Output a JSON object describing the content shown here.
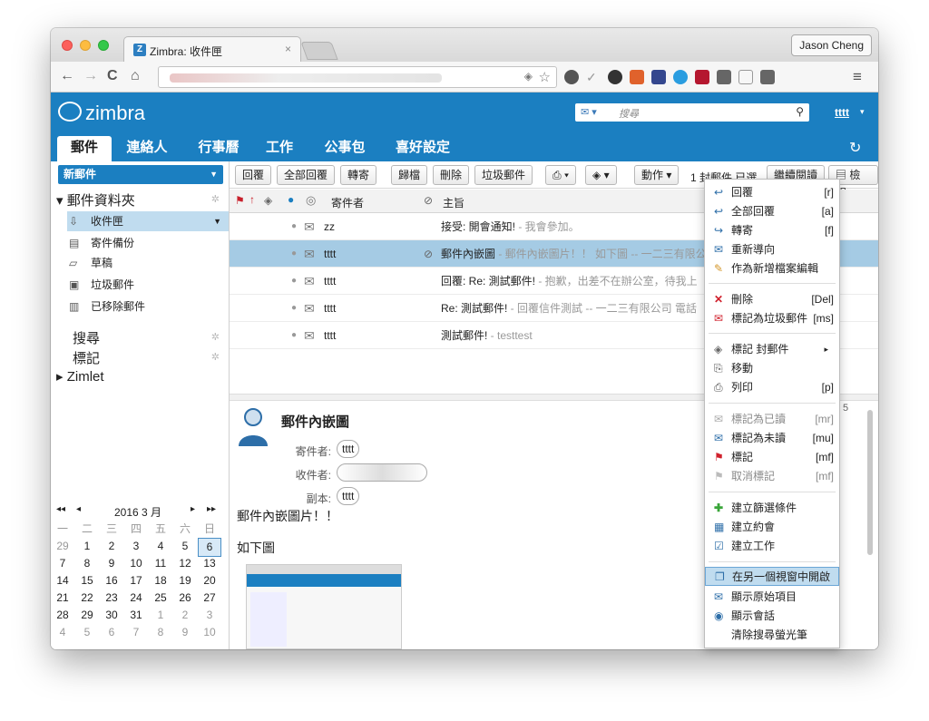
{
  "browser": {
    "tab_title": "Zimbra: 收件匣",
    "tab_close": "×",
    "user_button": "Jason Cheng"
  },
  "zimbra": {
    "logo": "zimbra",
    "search_placeholder": "搜尋",
    "user": "tttt",
    "app_tabs": [
      "郵件",
      "連絡人",
      "行事曆",
      "工作",
      "公事包",
      "喜好設定"
    ]
  },
  "sidebar": {
    "new_mail": "新郵件",
    "folders_header": "郵件資料夾",
    "folders": [
      "收件匣",
      "寄件備份",
      "草稿",
      "垃圾郵件",
      "已移除郵件"
    ],
    "search": "搜尋",
    "tags": "標記",
    "zimlet": "Zimlet"
  },
  "calendar": {
    "title": "2016 3 月",
    "weekdays": [
      "一",
      "二",
      "三",
      "四",
      "五",
      "六",
      "日"
    ],
    "weeks": [
      [
        "29",
        "1",
        "2",
        "3",
        "4",
        "5",
        "6"
      ],
      [
        "7",
        "8",
        "9",
        "10",
        "11",
        "12",
        "13"
      ],
      [
        "14",
        "15",
        "16",
        "17",
        "18",
        "19",
        "20"
      ],
      [
        "21",
        "22",
        "23",
        "24",
        "25",
        "26",
        "27"
      ],
      [
        "28",
        "29",
        "30",
        "31",
        "1",
        "2",
        "3"
      ],
      [
        "4",
        "5",
        "6",
        "7",
        "8",
        "9",
        "10"
      ]
    ],
    "today": "6"
  },
  "actions": {
    "reply": "回覆",
    "reply_all": "全部回覆",
    "forward": "轉寄",
    "archive": "歸檔",
    "delete": "刪除",
    "spam": "垃圾郵件",
    "action": "動作",
    "selected_count": "1 封郵件 已選",
    "continue_read": "繼續閱讀",
    "view": "檢視"
  },
  "list": {
    "col_from": "寄件者",
    "col_subject": "主旨",
    "messages": [
      {
        "from": "zz",
        "subject": "接受: 開會通知!",
        "fragment": " - 我會參加。"
      },
      {
        "from": "tttt",
        "subject": "郵件內嵌圖",
        "fragment": " - 郵件內嵌圖片！！ 如下圖 -- 一二三有限公"
      },
      {
        "from": "tttt",
        "subject": "回覆: Re: 測試郵件!",
        "fragment": " - 抱歉，出差不在辦公室，待我上"
      },
      {
        "from": "tttt",
        "subject": "Re: 測試郵件!",
        "fragment": " - 回覆信件測試 -- 一二三有限公司 電話"
      },
      {
        "from": "tttt",
        "subject": "測試郵件!",
        "fragment": " - testtest"
      }
    ]
  },
  "reading": {
    "title": "郵件內嵌圖",
    "from_label": "寄件者:",
    "from": "tttt",
    "to_label": "收件者:",
    "cc_label": "副本:",
    "cc": "tttt",
    "body1": "郵件內嵌圖片！！",
    "body2": "如下圖",
    "side_number": "5"
  },
  "context_menu": [
    {
      "label": "回覆",
      "key": "[r]"
    },
    {
      "label": "全部回覆",
      "key": "[a]"
    },
    {
      "label": "轉寄",
      "key": "[f]"
    },
    {
      "label": "重新導向",
      "key": ""
    },
    {
      "label": "作為新增檔案編輯",
      "key": ""
    },
    {
      "label": "刪除",
      "key": "[Del]"
    },
    {
      "label": "標記為垃圾郵件",
      "key": "[ms]"
    },
    {
      "label": "標記 封郵件",
      "key": "▸"
    },
    {
      "label": "移動",
      "key": ""
    },
    {
      "label": "列印",
      "key": "[p]"
    },
    {
      "label": "標記為已讀",
      "key": "[mr]"
    },
    {
      "label": "標記為未讀",
      "key": "[mu]"
    },
    {
      "label": "標記",
      "key": "[mf]"
    },
    {
      "label": "取消標記",
      "key": "[mf]"
    },
    {
      "label": "建立篩選條件",
      "key": ""
    },
    {
      "label": "建立約會",
      "key": ""
    },
    {
      "label": "建立工作",
      "key": ""
    },
    {
      "label": "在另一個視窗中開啟",
      "key": ""
    },
    {
      "label": "顯示原始項目",
      "key": ""
    },
    {
      "label": "顯示會話",
      "key": ""
    },
    {
      "label": "清除搜尋螢光筆",
      "key": ""
    }
  ]
}
